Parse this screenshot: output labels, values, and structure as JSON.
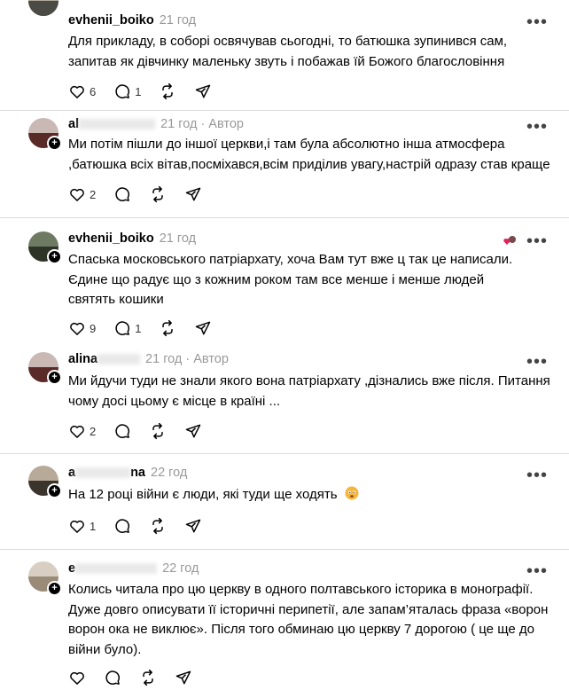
{
  "comments": [
    {
      "username": "evhenii_boiko",
      "time": "21 год",
      "author_label": "",
      "lines": [
        "Для прикладу, в соборі освячував сьогодні, то батюшка зупинився сам,",
        "запитав як дівчинку маленьку звуть і побажав їй Божого благословіння"
      ],
      "likes": "6",
      "replies": "1"
    },
    {
      "username": "al",
      "time": "21 год",
      "author_label": "Автор",
      "lines": [
        "Ми потім пішли до іншої церкви,і там була абсолютно інша атмосфера",
        ",батюшка всіх вітав,посміхався,всім приділив увагу,настрій одразу став краще"
      ],
      "likes": "2",
      "replies": ""
    },
    {
      "username": "evhenii_boiko",
      "time": "21 год",
      "author_label": "",
      "lines": [
        "Спаська московського патріархату, хоча Вам тут вже ц так це написали.",
        "Єдине що радує що з кожним роком там все менше і менше людей",
        "святять кошики"
      ],
      "likes": "9",
      "replies": "1"
    },
    {
      "username": "alina",
      "time": "21 год",
      "author_label": "Автор",
      "lines": [
        "Ми йдучи туди не знали якого вона патріархату ,дізнались вже після. Питання",
        "чому досі цьому є місце в країні ..."
      ],
      "likes": "2",
      "replies": ""
    },
    {
      "username": "a",
      "username_tail": "na",
      "time": "22 год",
      "author_label": "",
      "lines": [
        "На 12 році війни є люди, які туди ще ходять"
      ],
      "likes": "1",
      "replies": ""
    },
    {
      "username": "e",
      "time": "22 год",
      "author_label": "",
      "lines": [
        "Колись читала про цю церкву в одного полтавського історика в монографії.",
        "Дуже довго описувати її історичні перипетії, але запам’яталась фраза «ворон",
        "ворон ока не виклює». Після того обминаю цю церкву 7 дорогою ( це ще до",
        "війни було)."
      ],
      "likes": "",
      "replies": ""
    }
  ],
  "separator": "·",
  "more_label": "•••",
  "colors": {
    "text": "#000000",
    "muted": "#999999",
    "divider": "#dbdbdb"
  },
  "icons": [
    "heart-icon",
    "comment-icon",
    "repost-icon",
    "share-icon",
    "more-icon",
    "plus-icon"
  ]
}
